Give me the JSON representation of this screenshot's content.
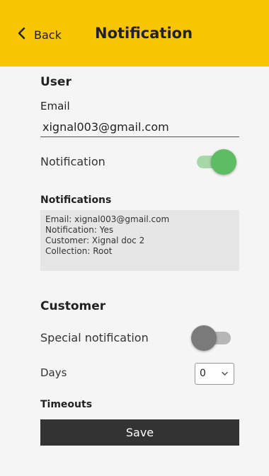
{
  "header": {
    "back_label": "Back",
    "title": "Notification",
    "background_color": "#f7c600"
  },
  "user": {
    "heading": "User",
    "email_label": "Email",
    "email_value": "xignal003@gmail.com",
    "notification_label": "Notification",
    "notification_enabled": true
  },
  "notifications": {
    "heading": "Notifications",
    "lines": [
      "Email: xignal003@gmail.com",
      "Notification: Yes",
      "Customer: Xignal doc 2",
      "Collection: Root"
    ]
  },
  "customer": {
    "heading": "Customer",
    "special_notification_label": "Special notification",
    "special_notification_enabled": false,
    "days_label": "Days",
    "days_value": "0"
  },
  "timeouts": {
    "heading": "Timeouts"
  },
  "actions": {
    "save_label": "Save"
  },
  "colors": {
    "toggle_on": "#5cbd63",
    "toggle_off": "#7a7a7a",
    "button_bg": "#333333"
  }
}
